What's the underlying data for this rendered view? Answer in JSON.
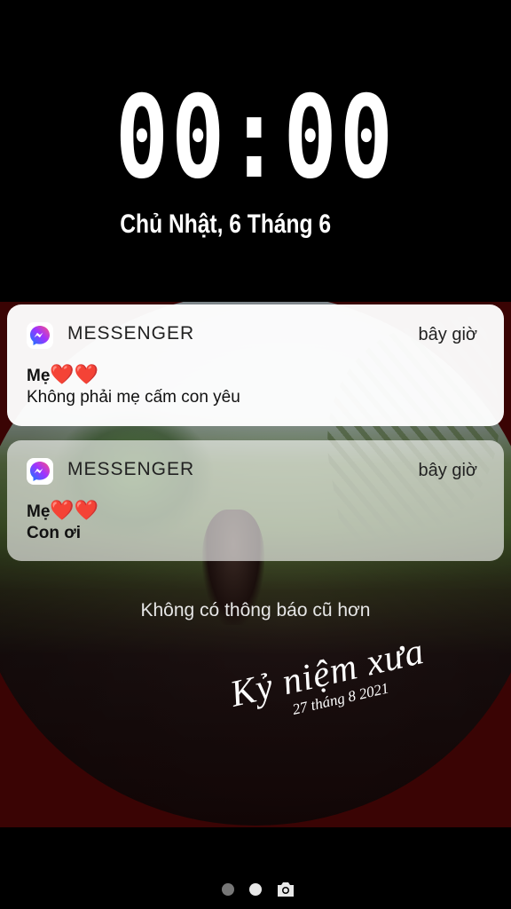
{
  "lockscreen": {
    "time": "00:00",
    "date": "Chủ Nhật, 6 Tháng 6"
  },
  "notifications": [
    {
      "app": "MESSENGER",
      "time": "bây giờ",
      "sender": "Mẹ",
      "sender_emoji": "❤️❤️",
      "message": "Không phải mẹ cấm con yêu",
      "icon": "messenger-icon"
    },
    {
      "app": "MESSENGER",
      "time": "bây giờ",
      "sender": "Mẹ",
      "sender_emoji": "❤️❤️",
      "message": "Con ơi",
      "icon": "messenger-icon"
    }
  ],
  "no_older_text": "Không có thông báo cũ hơn",
  "overlay": {
    "title": "Kỷ niệm xưa",
    "date": "27 tháng 8 2021"
  },
  "pager": {
    "pages": 2,
    "active_page": 2,
    "camera_icon": "camera-icon"
  },
  "colors": {
    "background": "#000000",
    "wallpaper_red": "#3a0404",
    "messenger_gradient": [
      "#0a7cff",
      "#a033ff",
      "#ff5280"
    ]
  }
}
